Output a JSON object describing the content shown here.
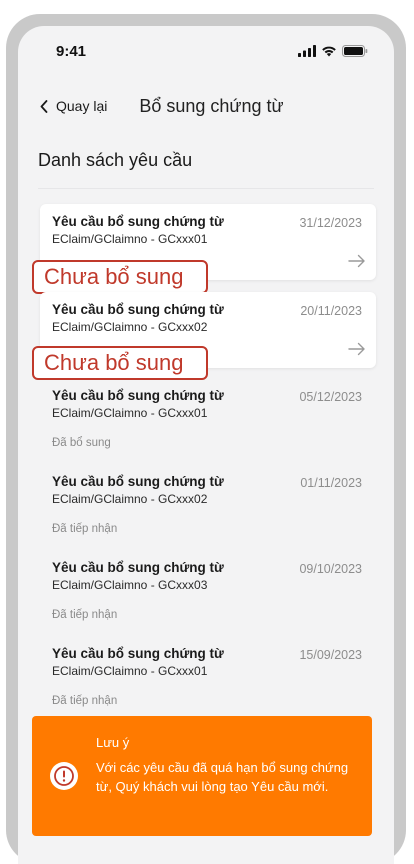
{
  "status_bar": {
    "time": "9:41"
  },
  "nav": {
    "back_label": "Quay lại",
    "title": "Bổ sung chứng từ"
  },
  "list": {
    "heading": "Danh sách yêu cầu",
    "items": [
      {
        "title": "Yêu cầu bổ sung chứng từ",
        "subtitle": "EClaim/GClaimno - GCxxx01",
        "date": "31/12/2023",
        "status": "Chưa bổ sung"
      },
      {
        "title": "Yêu cầu bổ sung chứng từ",
        "subtitle": "EClaim/GClaimno - GCxxx02",
        "date": "20/11/2023",
        "status": "Chưa bổ sung"
      },
      {
        "title": "Yêu cầu bổ sung chứng từ",
        "subtitle": "EClaim/GClaimno - GCxxx01",
        "date": "05/12/2023",
        "status": "Đã bổ sung"
      },
      {
        "title": "Yêu cầu bổ sung chứng từ",
        "subtitle": "EClaim/GClaimno - GCxxx02",
        "date": "01/11/2023",
        "status": "Đã tiếp nhận"
      },
      {
        "title": "Yêu cầu bổ sung chứng từ",
        "subtitle": "EClaim/GClaimno - GCxxx03",
        "date": "09/10/2023",
        "status": "Đã tiếp nhận"
      },
      {
        "title": "Yêu cầu bổ sung chứng từ",
        "subtitle": "EClaim/GClaimno - GCxxx01",
        "date": "15/09/2023",
        "status": "Đã tiếp nhận"
      }
    ]
  },
  "notice": {
    "title": "Lưu ý",
    "text": "Với các yêu cầu đã quá hạn bổ sung chứng từ, Quý khách vui lòng tạo Yêu cầu mới."
  },
  "colors": {
    "accent_orange": "#ff7a00",
    "highlight_red": "#c0392b",
    "background": "#f3f3f4"
  },
  "icons": {
    "back": "chevron-left-icon",
    "arrow": "arrow-right-icon",
    "notice": "exclamation-circle-icon",
    "signal": "signal-icon",
    "wifi": "wifi-icon",
    "battery": "battery-icon"
  }
}
